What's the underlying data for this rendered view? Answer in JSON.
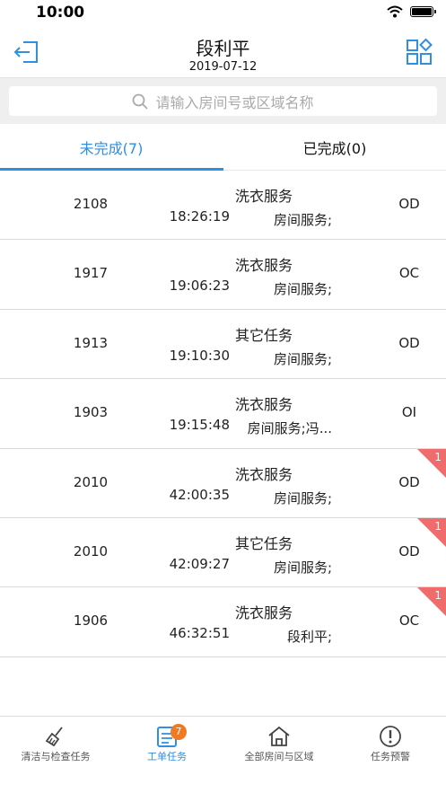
{
  "status_bar": {
    "time": "10:00"
  },
  "header": {
    "title": "段利平",
    "date": "2019-07-12"
  },
  "search": {
    "placeholder": "请输入房间号或区域名称"
  },
  "tabs": [
    {
      "label": "未完成(7)",
      "active": true
    },
    {
      "label": "已完成(0)",
      "active": false
    }
  ],
  "tasks": [
    {
      "room": "2108",
      "time": "18:26:19",
      "type": "洗衣服务",
      "desc": "房间服务;",
      "status": "OD",
      "badge": ""
    },
    {
      "room": "1917",
      "time": "19:06:23",
      "type": "洗衣服务",
      "desc": "房间服务;",
      "status": "OC",
      "badge": ""
    },
    {
      "room": "1913",
      "time": "19:10:30",
      "type": "其它任务",
      "desc": "房间服务;",
      "status": "OD",
      "badge": ""
    },
    {
      "room": "1903",
      "time": "19:15:48",
      "type": "洗衣服务",
      "desc": "房间服务;冯...",
      "status": "OI",
      "badge": ""
    },
    {
      "room": "2010",
      "time": "42:00:35",
      "type": "洗衣服务",
      "desc": "房间服务;",
      "status": "OD",
      "badge": "1"
    },
    {
      "room": "2010",
      "time": "42:09:27",
      "type": "其它任务",
      "desc": "房间服务;",
      "status": "OD",
      "badge": "1"
    },
    {
      "room": "1906",
      "time": "46:32:51",
      "type": "洗衣服务",
      "desc": "段利平;",
      "status": "OC",
      "badge": "1"
    }
  ],
  "tabbar": {
    "items": [
      {
        "label": "清洁与检查任务",
        "icon": "broom-icon"
      },
      {
        "label": "工单任务",
        "icon": "work-order-icon",
        "badge": "7",
        "active": true
      },
      {
        "label": "全部房间与区域",
        "icon": "home-icon"
      },
      {
        "label": "任务预警",
        "icon": "alert-icon"
      }
    ]
  },
  "colors": {
    "accent": "#2f8fe0",
    "badge_red": "#f06c6c",
    "badge_orange": "#f07a24"
  }
}
